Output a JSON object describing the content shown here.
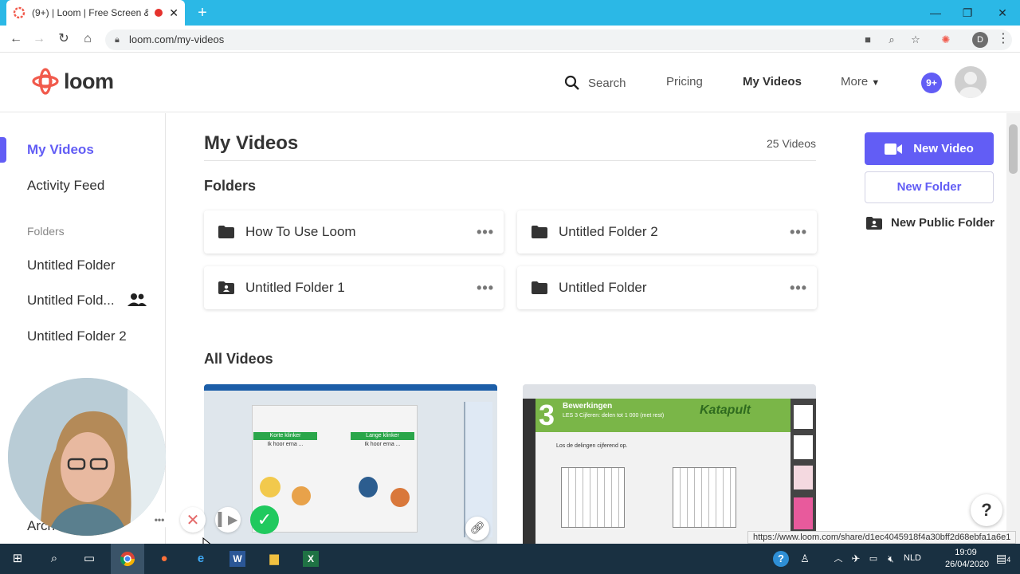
{
  "browser": {
    "tab_title": "(9+) | Loom | Free Screen & •",
    "url": "loom.com/my-videos",
    "new_tab_symbol": "+",
    "profile_initial": "D"
  },
  "header": {
    "brand": "loom",
    "search_label": "Search",
    "pricing_label": "Pricing",
    "my_videos_label": "My Videos",
    "more_label": "More",
    "notification_badge": "9+"
  },
  "sidebar": {
    "my_videos": "My Videos",
    "activity_feed": "Activity Feed",
    "folders_heading": "Folders",
    "folders": [
      "Untitled Folder",
      "Untitled Fold...",
      "Untitled Folder 2"
    ],
    "partial_item": "Arch"
  },
  "main": {
    "title": "My Videos",
    "video_count": "25 Videos",
    "folders_heading": "Folders",
    "folders": [
      {
        "name": "How To Use Loom",
        "icon": "folder-icon"
      },
      {
        "name": "Untitled Folder 2",
        "icon": "folder-icon"
      },
      {
        "name": "Untitled Folder 1",
        "icon": "shared-folder-icon"
      },
      {
        "name": "Untitled Folder",
        "icon": "folder-icon"
      }
    ],
    "all_videos_heading": "All Videos",
    "thumb2_texts": {
      "number": "3",
      "heading": "Bewerkingen",
      "sub": "LES 3  Cijferen: delen tot 1 000 (met rest)",
      "brand": "Katapult",
      "instruction": "Los de delingen cijferend op."
    },
    "thumb1_texts": {
      "left_col": "Korte klinker",
      "right_col": "Lange klinker",
      "hint": "Ik hoor erna ..."
    }
  },
  "actions": {
    "new_video": "New Video",
    "new_folder": "New Folder",
    "new_public_folder": "New Public Folder"
  },
  "status_url": "https://www.loom.com/share/d1ec4045918f4a30bff2d68ebfa1a6e1",
  "help_symbol": "?",
  "taskbar": {
    "language": "NLD",
    "time": "19:09",
    "date": "26/04/2020",
    "notification_count": "4"
  },
  "colors": {
    "accent": "#625df5",
    "browser_bar": "#2bb8e6",
    "taskbar": "#193041",
    "record_done": "#20c95e",
    "loom_logo": "#f15a4c"
  }
}
